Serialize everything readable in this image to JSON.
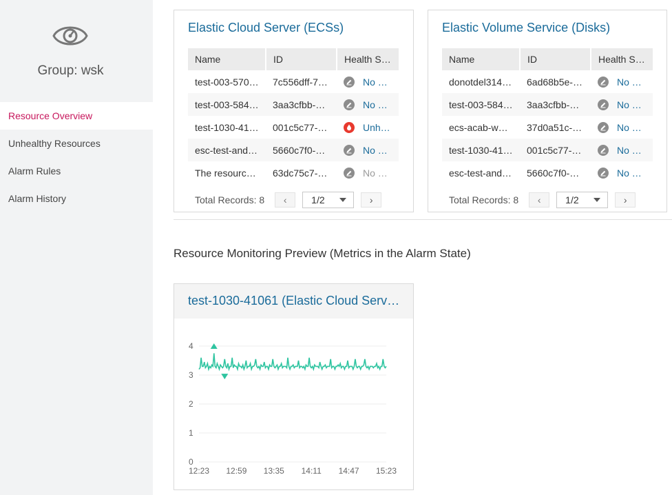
{
  "sidebar": {
    "group_title": "Group: wsk",
    "items": [
      {
        "label": "Resource Overview",
        "active": true
      },
      {
        "label": "Unhealthy Resources",
        "active": false
      },
      {
        "label": "Alarm Rules",
        "active": false
      },
      {
        "label": "Alarm History",
        "active": false
      }
    ]
  },
  "ecs_panel": {
    "title": "Elastic Cloud Server (ECSs)",
    "columns": [
      "Name",
      "ID",
      "Health S…"
    ],
    "rows": [
      {
        "name": "test-003-570…",
        "id": "7c556dff-7…",
        "health_icon": "pencil-icon",
        "health": "No …",
        "state": "normal"
      },
      {
        "name": "test-003-584…",
        "id": "3aa3cfbb-…",
        "health_icon": "pencil-icon",
        "health": "No …",
        "state": "normal"
      },
      {
        "name": "test-1030-41…",
        "id": "001c5c77-…",
        "health_icon": "alarm-drop-icon",
        "health": "Unh…",
        "state": "alarm"
      },
      {
        "name": "esc-test-and…",
        "id": "5660c7f0-…",
        "health_icon": "pencil-icon",
        "health": "No …",
        "state": "normal"
      },
      {
        "name": "The resourc…",
        "id": "63dc75c7-…",
        "health_icon": "pencil-icon",
        "health": "No …",
        "state": "muted"
      }
    ],
    "total_label": "Total Records: 8",
    "page": "1/2"
  },
  "evs_panel": {
    "title": "Elastic Volume Service (Disks)",
    "columns": [
      "Name",
      "ID",
      "Health S…"
    ],
    "rows": [
      {
        "name": "donotdel314…",
        "id": "6ad68b5e-…",
        "health_icon": "pencil-icon",
        "health": "No …",
        "state": "normal"
      },
      {
        "name": "test-003-584…",
        "id": "3aa3cfbb-…",
        "health_icon": "pencil-icon",
        "health": "No …",
        "state": "normal"
      },
      {
        "name": "ecs-acab-w…",
        "id": "37d0a51c-…",
        "health_icon": "pencil-icon",
        "health": "No …",
        "state": "normal"
      },
      {
        "name": "test-1030-41…",
        "id": "001c5c77-…",
        "health_icon": "pencil-icon",
        "health": "No …",
        "state": "normal"
      },
      {
        "name": "esc-test-and…",
        "id": "5660c7f0-…",
        "health_icon": "pencil-icon",
        "health": "No …",
        "state": "normal"
      }
    ],
    "total_label": "Total Records: 8",
    "page": "1/2"
  },
  "monitoring": {
    "section_title": "Resource Monitoring Preview (Metrics in the Alarm State)",
    "card_title": "test-1030-41061 (Elastic Cloud Serv…"
  },
  "colors": {
    "accent": "#c7175c",
    "link": "#1a6b9a",
    "series": "#2ec4a0",
    "alarm": "#e8392e"
  },
  "chart_data": {
    "type": "line",
    "title": "",
    "xlabel": "",
    "ylabel": "",
    "xticks": [
      "12:23",
      "12:59",
      "13:35",
      "14:11",
      "14:47",
      "15:23"
    ],
    "yticks": [
      0,
      1,
      2,
      3,
      4
    ],
    "ylim": [
      0,
      4
    ],
    "grid": true,
    "series": [
      {
        "values": [
          3.2,
          3.25,
          3.6,
          3.3,
          3.3,
          3.45,
          3.25,
          3.3,
          3.4,
          3.2,
          3.3,
          3.25,
          3.35,
          3.3,
          3.75,
          3.3,
          3.25,
          3.4,
          3.3,
          3.2,
          3.35,
          3.3,
          3.25,
          3.3,
          3.55,
          3.3,
          3.25,
          3.4,
          3.2,
          3.3,
          3.3,
          3.6,
          3.25,
          3.35,
          3.3,
          3.3,
          3.2,
          3.4,
          3.3,
          3.3,
          3.25,
          3.35,
          3.2,
          3.3,
          3.5,
          3.25,
          3.3,
          3.3,
          3.4,
          3.2,
          3.3,
          3.3,
          3.35,
          3.55,
          3.3,
          3.25,
          3.3,
          3.2,
          3.35,
          3.3,
          3.3,
          3.45,
          3.25,
          3.3,
          3.3,
          3.2,
          3.35,
          3.3,
          3.3,
          3.55,
          3.3,
          3.25,
          3.3,
          3.35,
          3.2,
          3.3,
          3.3,
          3.4,
          3.25,
          3.3,
          3.3,
          3.3,
          3.25,
          3.6,
          3.3,
          3.2,
          3.3,
          3.3,
          3.35,
          3.25,
          3.3,
          3.3,
          3.3,
          3.5,
          3.25,
          3.3,
          3.3,
          3.25,
          3.3,
          3.2,
          3.35,
          3.3,
          3.3,
          3.6,
          3.3,
          3.25,
          3.3,
          3.2,
          3.35,
          3.3,
          3.3,
          3.3,
          3.25,
          3.45,
          3.3,
          3.2,
          3.3,
          3.3,
          3.35,
          3.25,
          3.3,
          3.3,
          3.3,
          3.55,
          3.25,
          3.3,
          3.3,
          3.2,
          3.3,
          3.3,
          3.35,
          3.3,
          3.4,
          3.25,
          3.3,
          3.3,
          3.2,
          3.3,
          3.3,
          3.5,
          3.25,
          3.3,
          3.3,
          3.3,
          3.2,
          3.3,
          3.55,
          3.3,
          3.25,
          3.3,
          3.3,
          3.2,
          3.3,
          3.3,
          3.35,
          3.55,
          3.3,
          3.25,
          3.3,
          3.2,
          3.3,
          3.3,
          3.3,
          3.25,
          3.3,
          3.3,
          3.4,
          3.25,
          3.3,
          3.2,
          3.3,
          3.3,
          3.55,
          3.3,
          3.25,
          3.3
        ],
        "max_marker_index": 14,
        "min_marker_index": 24,
        "max_marker_value": 4.0,
        "min_marker_value": 2.95
      }
    ]
  }
}
